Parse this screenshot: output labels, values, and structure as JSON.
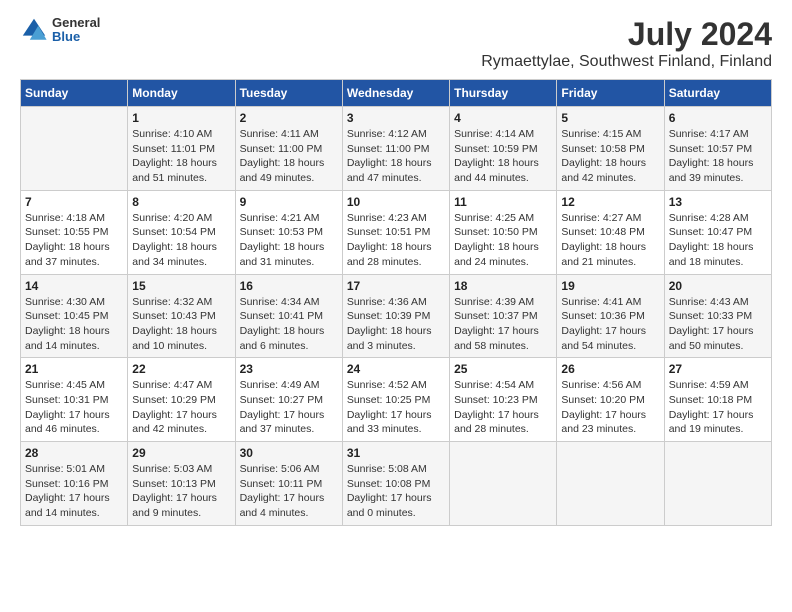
{
  "header": {
    "logo_general": "General",
    "logo_blue": "Blue",
    "main_title": "July 2024",
    "subtitle": "Rymaettylae, Southwest Finland, Finland"
  },
  "calendar": {
    "weekdays": [
      "Sunday",
      "Monday",
      "Tuesday",
      "Wednesday",
      "Thursday",
      "Friday",
      "Saturday"
    ],
    "weeks": [
      [
        {
          "day": "",
          "info": ""
        },
        {
          "day": "1",
          "info": "Sunrise: 4:10 AM\nSunset: 11:01 PM\nDaylight: 18 hours\nand 51 minutes."
        },
        {
          "day": "2",
          "info": "Sunrise: 4:11 AM\nSunset: 11:00 PM\nDaylight: 18 hours\nand 49 minutes."
        },
        {
          "day": "3",
          "info": "Sunrise: 4:12 AM\nSunset: 11:00 PM\nDaylight: 18 hours\nand 47 minutes."
        },
        {
          "day": "4",
          "info": "Sunrise: 4:14 AM\nSunset: 10:59 PM\nDaylight: 18 hours\nand 44 minutes."
        },
        {
          "day": "5",
          "info": "Sunrise: 4:15 AM\nSunset: 10:58 PM\nDaylight: 18 hours\nand 42 minutes."
        },
        {
          "day": "6",
          "info": "Sunrise: 4:17 AM\nSunset: 10:57 PM\nDaylight: 18 hours\nand 39 minutes."
        }
      ],
      [
        {
          "day": "7",
          "info": "Sunrise: 4:18 AM\nSunset: 10:55 PM\nDaylight: 18 hours\nand 37 minutes."
        },
        {
          "day": "8",
          "info": "Sunrise: 4:20 AM\nSunset: 10:54 PM\nDaylight: 18 hours\nand 34 minutes."
        },
        {
          "day": "9",
          "info": "Sunrise: 4:21 AM\nSunset: 10:53 PM\nDaylight: 18 hours\nand 31 minutes."
        },
        {
          "day": "10",
          "info": "Sunrise: 4:23 AM\nSunset: 10:51 PM\nDaylight: 18 hours\nand 28 minutes."
        },
        {
          "day": "11",
          "info": "Sunrise: 4:25 AM\nSunset: 10:50 PM\nDaylight: 18 hours\nand 24 minutes."
        },
        {
          "day": "12",
          "info": "Sunrise: 4:27 AM\nSunset: 10:48 PM\nDaylight: 18 hours\nand 21 minutes."
        },
        {
          "day": "13",
          "info": "Sunrise: 4:28 AM\nSunset: 10:47 PM\nDaylight: 18 hours\nand 18 minutes."
        }
      ],
      [
        {
          "day": "14",
          "info": "Sunrise: 4:30 AM\nSunset: 10:45 PM\nDaylight: 18 hours\nand 14 minutes."
        },
        {
          "day": "15",
          "info": "Sunrise: 4:32 AM\nSunset: 10:43 PM\nDaylight: 18 hours\nand 10 minutes."
        },
        {
          "day": "16",
          "info": "Sunrise: 4:34 AM\nSunset: 10:41 PM\nDaylight: 18 hours\nand 6 minutes."
        },
        {
          "day": "17",
          "info": "Sunrise: 4:36 AM\nSunset: 10:39 PM\nDaylight: 18 hours\nand 3 minutes."
        },
        {
          "day": "18",
          "info": "Sunrise: 4:39 AM\nSunset: 10:37 PM\nDaylight: 17 hours\nand 58 minutes."
        },
        {
          "day": "19",
          "info": "Sunrise: 4:41 AM\nSunset: 10:36 PM\nDaylight: 17 hours\nand 54 minutes."
        },
        {
          "day": "20",
          "info": "Sunrise: 4:43 AM\nSunset: 10:33 PM\nDaylight: 17 hours\nand 50 minutes."
        }
      ],
      [
        {
          "day": "21",
          "info": "Sunrise: 4:45 AM\nSunset: 10:31 PM\nDaylight: 17 hours\nand 46 minutes."
        },
        {
          "day": "22",
          "info": "Sunrise: 4:47 AM\nSunset: 10:29 PM\nDaylight: 17 hours\nand 42 minutes."
        },
        {
          "day": "23",
          "info": "Sunrise: 4:49 AM\nSunset: 10:27 PM\nDaylight: 17 hours\nand 37 minutes."
        },
        {
          "day": "24",
          "info": "Sunrise: 4:52 AM\nSunset: 10:25 PM\nDaylight: 17 hours\nand 33 minutes."
        },
        {
          "day": "25",
          "info": "Sunrise: 4:54 AM\nSunset: 10:23 PM\nDaylight: 17 hours\nand 28 minutes."
        },
        {
          "day": "26",
          "info": "Sunrise: 4:56 AM\nSunset: 10:20 PM\nDaylight: 17 hours\nand 23 minutes."
        },
        {
          "day": "27",
          "info": "Sunrise: 4:59 AM\nSunset: 10:18 PM\nDaylight: 17 hours\nand 19 minutes."
        }
      ],
      [
        {
          "day": "28",
          "info": "Sunrise: 5:01 AM\nSunset: 10:16 PM\nDaylight: 17 hours\nand 14 minutes."
        },
        {
          "day": "29",
          "info": "Sunrise: 5:03 AM\nSunset: 10:13 PM\nDaylight: 17 hours\nand 9 minutes."
        },
        {
          "day": "30",
          "info": "Sunrise: 5:06 AM\nSunset: 10:11 PM\nDaylight: 17 hours\nand 4 minutes."
        },
        {
          "day": "31",
          "info": "Sunrise: 5:08 AM\nSunset: 10:08 PM\nDaylight: 17 hours\nand 0 minutes."
        },
        {
          "day": "",
          "info": ""
        },
        {
          "day": "",
          "info": ""
        },
        {
          "day": "",
          "info": ""
        }
      ]
    ]
  }
}
